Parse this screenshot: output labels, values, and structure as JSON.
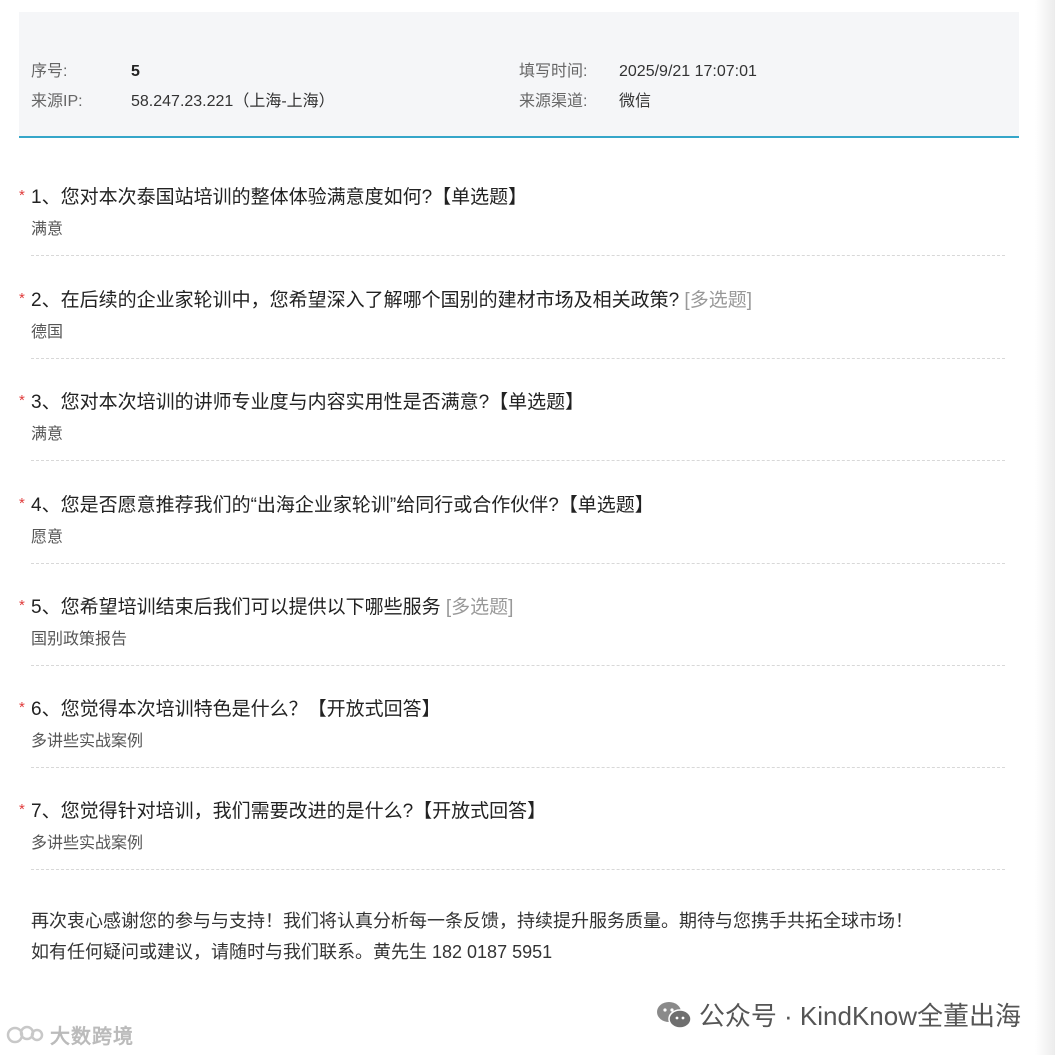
{
  "header": {
    "serial_label": "序号:",
    "serial_value": "5",
    "ip_label": "来源IP:",
    "ip_value": "58.247.23.221（上海-上海）",
    "time_label": "填写时间:",
    "time_value": "2025/9/21 17:07:01",
    "channel_label": "来源渠道:",
    "channel_value": "微信"
  },
  "questions": [
    {
      "star": "*",
      "title": "1、您对本次泰国站培训的整体体验满意度如何?",
      "type": "【单选题】",
      "answer": "满意"
    },
    {
      "star": "*",
      "title": "2、在后续的企业家轮训中，您希望深入了解哪个国别的建材市场及相关政策?",
      "type": "[多选题]",
      "answer": "德国"
    },
    {
      "star": "*",
      "title": "3、您对本次培训的讲师专业度与内容实用性是否满意?",
      "type": "【单选题】",
      "answer": "满意"
    },
    {
      "star": "*",
      "title": "4、您是否愿意推荐我们的“出海企业家轮训”给同行或合作伙伴?",
      "type": "【单选题】",
      "answer": "愿意"
    },
    {
      "star": "*",
      "title": "5、您希望培训结束后我们可以提供以下哪些服务",
      "type": "[多选题]",
      "answer": "国别政策报告"
    },
    {
      "star": "*",
      "title": "6、您觉得本次培训特色是什么？",
      "type": "【开放式回答】",
      "answer": "多讲些实战案例"
    },
    {
      "star": "*",
      "title": "7、您觉得针对培训，我们需要改进的是什么?",
      "type": "【开放式回答】",
      "answer": "多讲些实战案例"
    }
  ],
  "closing": {
    "line1": "再次衷心感谢您的参与与支持！我们将认真分析每一条反馈，持续提升服务质量。期待与您携手共拓全球市场！",
    "line2": "如有任何疑问或建议，请随时与我们联系。黄先生 182 0187 5951"
  },
  "watermark": {
    "text": "公众号 · KindKnow全董出海",
    "left_text": "大数跨境"
  },
  "colors": {
    "accent_line": "#35a6c9",
    "required_star": "#e03b3b",
    "panel_bg": "#f5f6f8"
  }
}
